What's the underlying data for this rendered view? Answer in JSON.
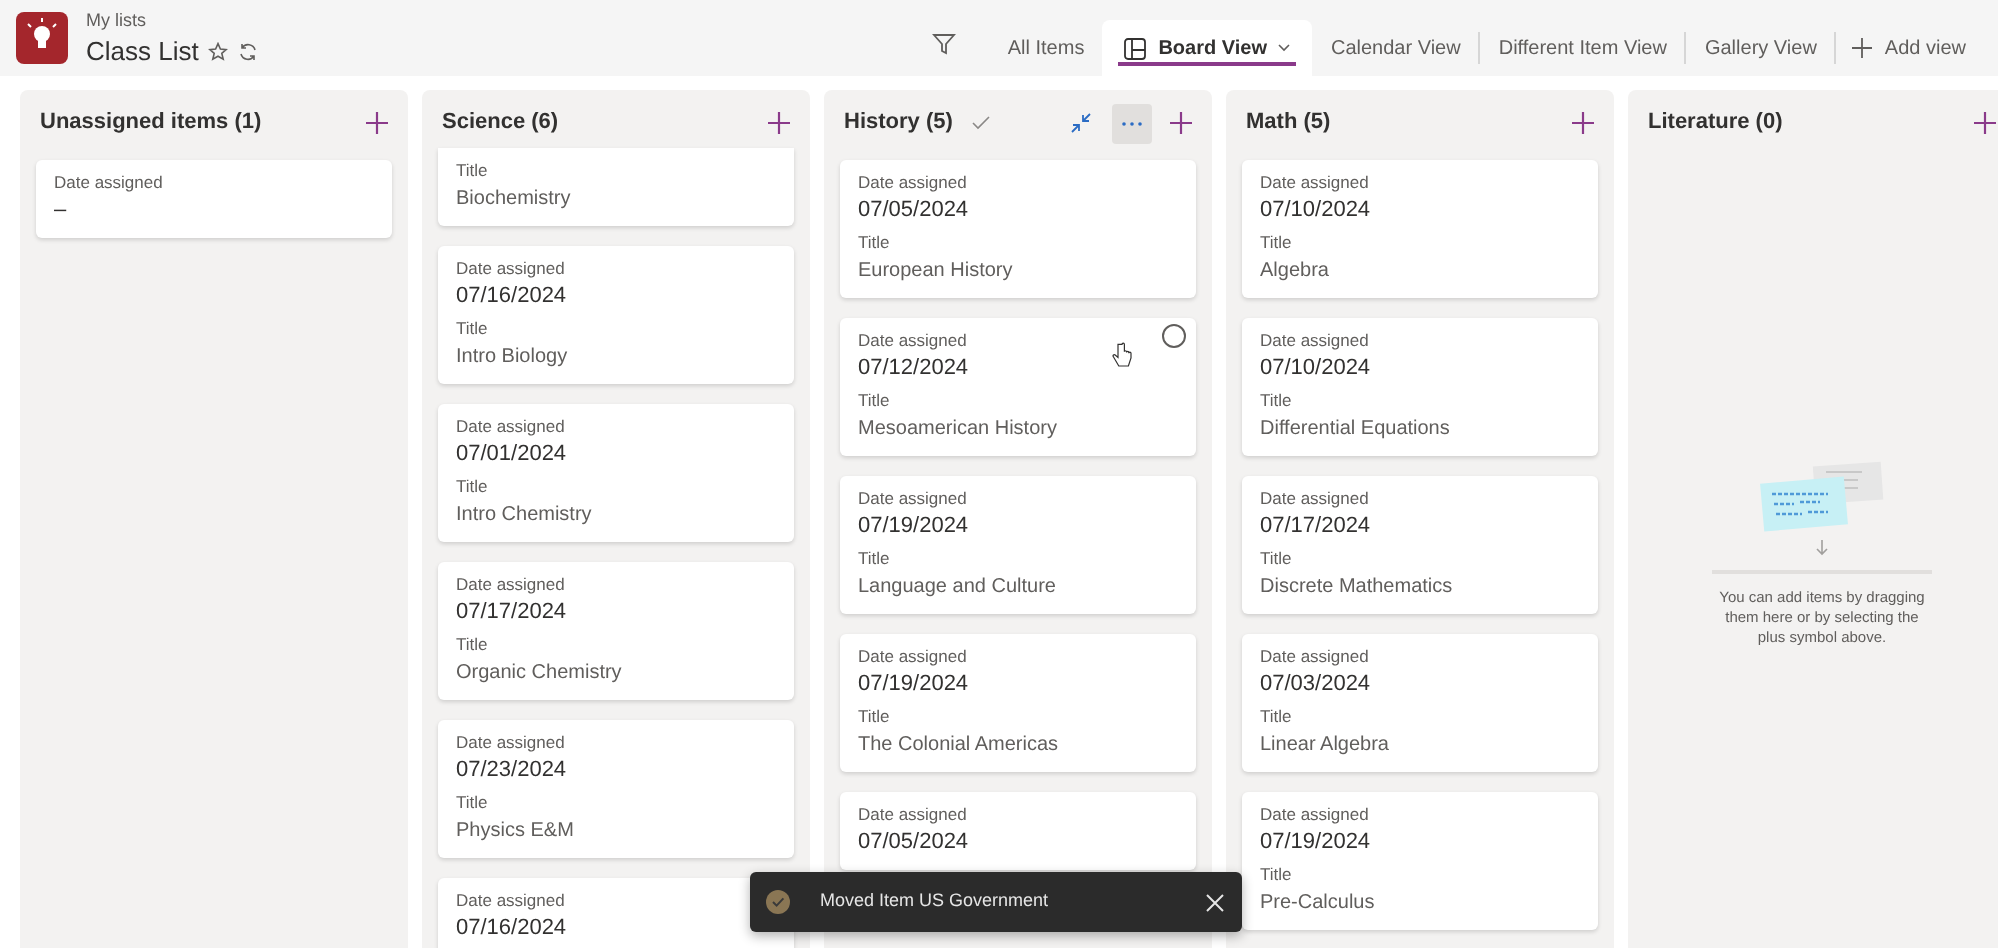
{
  "header": {
    "breadcrumb": "My lists",
    "title": "Class List"
  },
  "views": [
    {
      "label": "All Items",
      "selected": false
    },
    {
      "label": "Board View",
      "selected": true
    },
    {
      "label": "Calendar View",
      "selected": false
    },
    {
      "label": "Different Item View",
      "selected": false
    },
    {
      "label": "Gallery View",
      "selected": false
    }
  ],
  "add_view": "Add view",
  "columns": [
    {
      "title": "Unassigned items (1)",
      "focused": false,
      "cards": [
        {
          "hovered": false,
          "fields": [
            {
              "label": "Date assigned",
              "value": "–",
              "kind": "date"
            }
          ]
        }
      ]
    },
    {
      "title": "Science (6)",
      "focused": false,
      "cards": [
        {
          "hovered": false,
          "fields": [
            {
              "label": "Title",
              "value": "Biochemistry",
              "kind": "text"
            }
          ]
        },
        {
          "hovered": false,
          "fields": [
            {
              "label": "Date assigned",
              "value": "07/16/2024",
              "kind": "date"
            },
            {
              "label": "Title",
              "value": "Intro Biology",
              "kind": "text"
            }
          ]
        },
        {
          "hovered": false,
          "fields": [
            {
              "label": "Date assigned",
              "value": "07/01/2024",
              "kind": "date"
            },
            {
              "label": "Title",
              "value": "Intro Chemistry",
              "kind": "text"
            }
          ]
        },
        {
          "hovered": false,
          "fields": [
            {
              "label": "Date assigned",
              "value": "07/17/2024",
              "kind": "date"
            },
            {
              "label": "Title",
              "value": "Organic Chemistry",
              "kind": "text"
            }
          ]
        },
        {
          "hovered": false,
          "fields": [
            {
              "label": "Date assigned",
              "value": "07/23/2024",
              "kind": "date"
            },
            {
              "label": "Title",
              "value": "Physics E&M",
              "kind": "text"
            }
          ]
        },
        {
          "hovered": false,
          "fields": [
            {
              "label": "Date assigned",
              "value": "07/16/2024",
              "kind": "date"
            }
          ]
        }
      ]
    },
    {
      "title": "History (5)",
      "focused": true,
      "cards": [
        {
          "hovered": false,
          "fields": [
            {
              "label": "Date assigned",
              "value": "07/05/2024",
              "kind": "date"
            },
            {
              "label": "Title",
              "value": "European History",
              "kind": "text"
            }
          ]
        },
        {
          "hovered": true,
          "fields": [
            {
              "label": "Date assigned",
              "value": "07/12/2024",
              "kind": "date"
            },
            {
              "label": "Title",
              "value": "Mesoamerican History",
              "kind": "text"
            }
          ]
        },
        {
          "hovered": false,
          "fields": [
            {
              "label": "Date assigned",
              "value": "07/19/2024",
              "kind": "date"
            },
            {
              "label": "Title",
              "value": "Language and Culture",
              "kind": "text"
            }
          ]
        },
        {
          "hovered": false,
          "fields": [
            {
              "label": "Date assigned",
              "value": "07/19/2024",
              "kind": "date"
            },
            {
              "label": "Title",
              "value": "The Colonial Americas",
              "kind": "text"
            }
          ]
        },
        {
          "hovered": false,
          "fields": [
            {
              "label": "Date assigned",
              "value": "07/05/2024",
              "kind": "date"
            }
          ]
        }
      ]
    },
    {
      "title": "Math (5)",
      "focused": false,
      "cards": [
        {
          "hovered": false,
          "fields": [
            {
              "label": "Date assigned",
              "value": "07/10/2024",
              "kind": "date"
            },
            {
              "label": "Title",
              "value": "Algebra",
              "kind": "text"
            }
          ]
        },
        {
          "hovered": false,
          "fields": [
            {
              "label": "Date assigned",
              "value": "07/10/2024",
              "kind": "date"
            },
            {
              "label": "Title",
              "value": "Differential Equations",
              "kind": "text"
            }
          ]
        },
        {
          "hovered": false,
          "fields": [
            {
              "label": "Date assigned",
              "value": "07/17/2024",
              "kind": "date"
            },
            {
              "label": "Title",
              "value": "Discrete Mathematics",
              "kind": "text"
            }
          ]
        },
        {
          "hovered": false,
          "fields": [
            {
              "label": "Date assigned",
              "value": "07/03/2024",
              "kind": "date"
            },
            {
              "label": "Title",
              "value": "Linear Algebra",
              "kind": "text"
            }
          ]
        },
        {
          "hovered": false,
          "fields": [
            {
              "label": "Date assigned",
              "value": "07/19/2024",
              "kind": "date"
            },
            {
              "label": "Title",
              "value": "Pre-Calculus",
              "kind": "text"
            }
          ]
        }
      ]
    },
    {
      "title": "Literature (0)",
      "focused": false,
      "empty_message": "You can add items by dragging them here or by selecting the plus symbol above."
    }
  ],
  "toast": {
    "message": "Moved Item US Government"
  }
}
